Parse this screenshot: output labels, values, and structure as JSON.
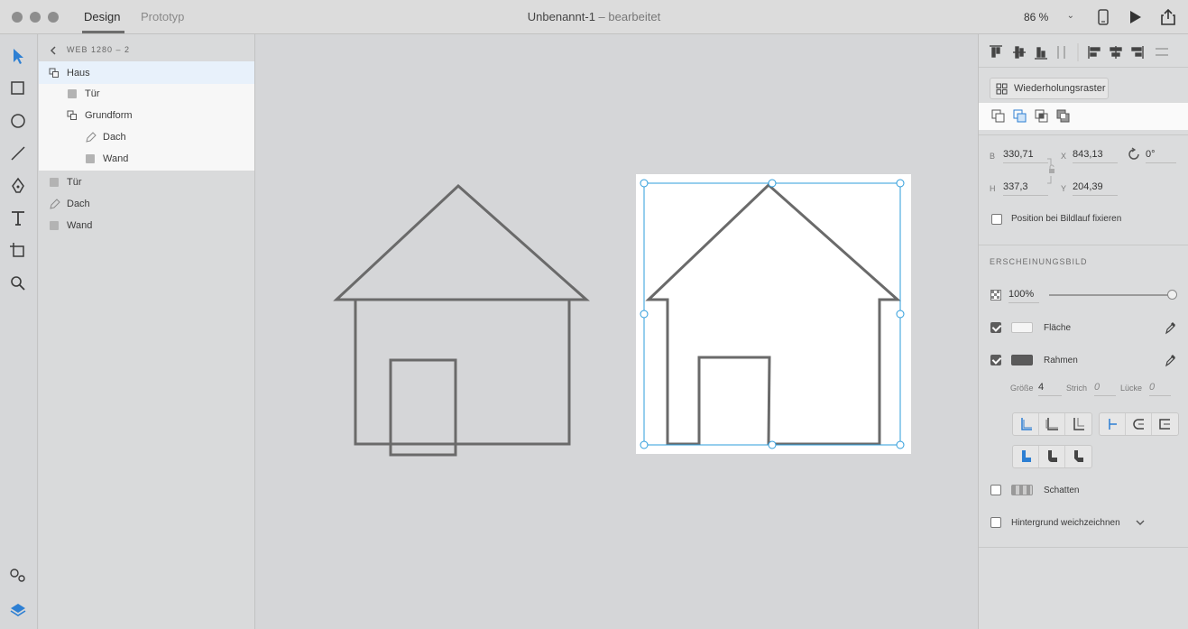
{
  "window": {
    "tabs": [
      {
        "label": "Design",
        "active": true
      },
      {
        "label": "Prototyp",
        "active": false
      }
    ],
    "doc_name": "Unbenannt-1",
    "doc_status": " – bearbeitet",
    "zoom": "86 %"
  },
  "layers": {
    "artboard": "WEB 1280 – 2",
    "group": "Haus",
    "group_children": [
      {
        "label": "Tür",
        "icon": "rectangle-icon"
      },
      {
        "label": "Grundform",
        "icon": "group-icon"
      },
      {
        "label": "Dach",
        "icon": "pen-path-icon"
      },
      {
        "label": "Wand",
        "icon": "rectangle-icon"
      }
    ],
    "top_items": [
      {
        "label": "Tür",
        "icon": "rectangle-icon"
      },
      {
        "label": "Dach",
        "icon": "pen-path-icon"
      },
      {
        "label": "Wand",
        "icon": "rectangle-icon"
      }
    ]
  },
  "props": {
    "repeat_grid": "Wiederholungsraster",
    "w_label": "B",
    "w_value": "330,71",
    "x_label": "X",
    "x_value": "843,13",
    "rotation": "0°",
    "h_label": "H",
    "h_value": "337,3",
    "y_label": "Y",
    "y_value": "204,39",
    "fix_position": "Position bei Bildlauf fixieren",
    "appearance": "ERSCHEINUNGSBILD",
    "opacity": "100%",
    "opacity_fraction": 1.0,
    "fill_label": "Fläche",
    "border_label": "Rahmen",
    "size_label": "Größe",
    "size_value": "4",
    "dash_label": "Strich",
    "dash_value": "0",
    "gap_label": "Lücke",
    "gap_value": "0",
    "shadow_label": "Schatten",
    "blur_label": "Hintergrund weichzeichnen"
  },
  "colors": {
    "accent": "#2d7fd3",
    "stroke": "#6a6a6a",
    "selection": "#2d9cdb"
  }
}
